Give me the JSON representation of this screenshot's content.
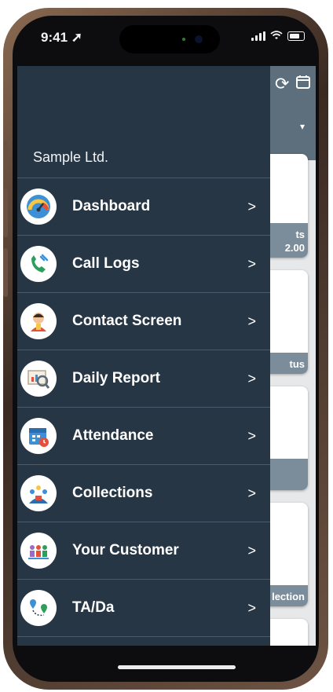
{
  "status_bar": {
    "time": "9:41"
  },
  "drawer": {
    "company_name": "Sample Ltd.",
    "items": [
      {
        "label": "Dashboard",
        "icon": "dashboard-gauge-icon"
      },
      {
        "label": "Call Logs",
        "icon": "phone-call-icon"
      },
      {
        "label": "Contact Screen",
        "icon": "contact-person-icon"
      },
      {
        "label": "Daily Report",
        "icon": "report-magnifier-icon"
      },
      {
        "label": "Attendance",
        "icon": "calendar-clock-icon"
      },
      {
        "label": "Collections",
        "icon": "collections-people-icon"
      },
      {
        "label": "Your Customer",
        "icon": "customers-group-icon"
      },
      {
        "label": "TA/Da",
        "icon": "travel-route-icon"
      }
    ]
  },
  "background_app": {
    "card1_caption_line1": "ts",
    "card1_caption_line2": "2.00",
    "card2_caption": "tus",
    "card4_caption": "lection"
  },
  "colors": {
    "drawer_bg": "#263645",
    "divider": "#4a5c6c",
    "header_bg": "#5d6f7c"
  }
}
